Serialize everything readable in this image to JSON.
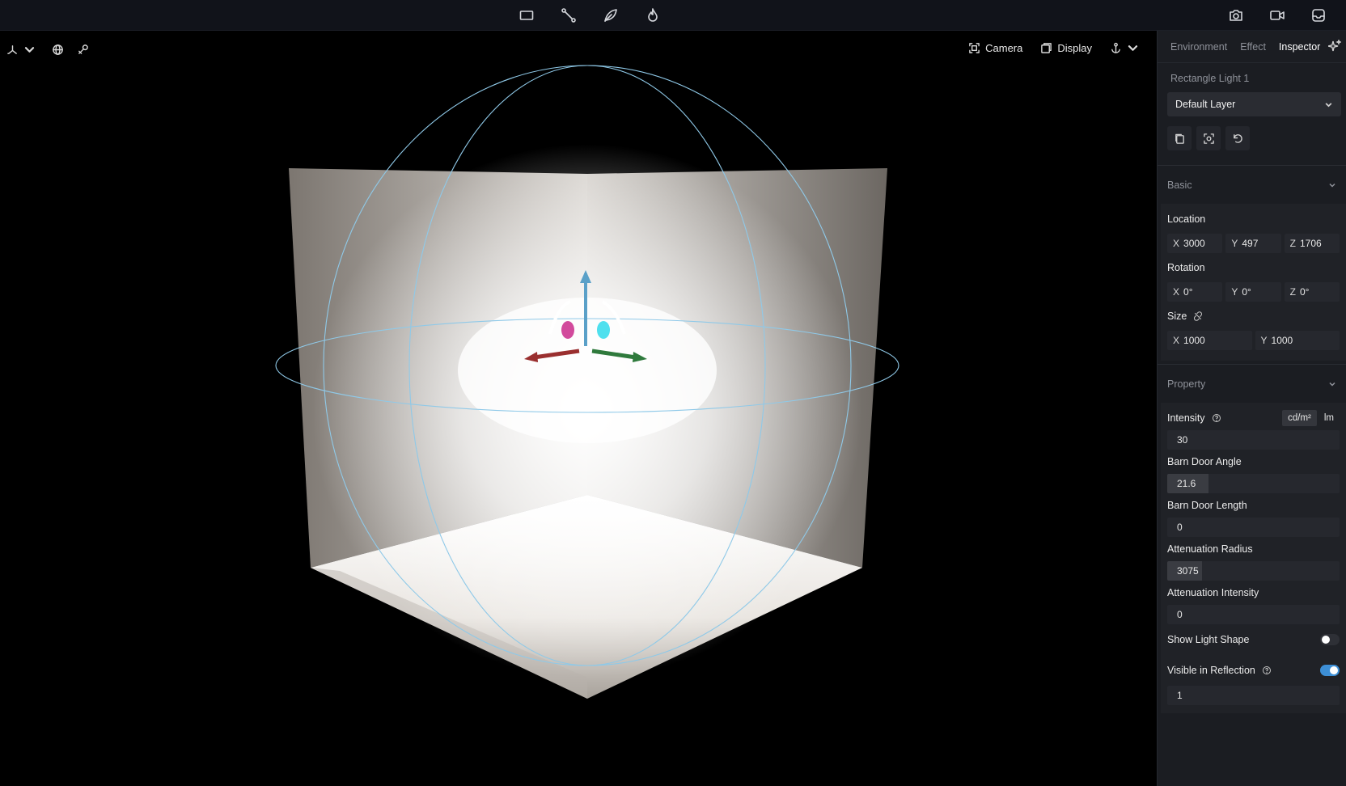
{
  "topbar": {
    "tools": [
      {
        "name": "rectangle-tool",
        "icon": "rectangle-icon"
      },
      {
        "name": "path-tool",
        "icon": "node-path-icon"
      },
      {
        "name": "leaf-tool",
        "icon": "leaf-icon"
      },
      {
        "name": "fire-tool",
        "icon": "flame-icon"
      }
    ],
    "capture": [
      {
        "name": "screenshot-button",
        "icon": "camera-icon"
      },
      {
        "name": "record-button",
        "icon": "video-icon"
      },
      {
        "name": "export-button",
        "icon": "tray-icon"
      }
    ]
  },
  "viewport": {
    "camera_label": "Camera",
    "display_label": "Display"
  },
  "panel": {
    "tabs": [
      {
        "label": "Environment",
        "active": false
      },
      {
        "label": "Effect",
        "active": false
      },
      {
        "label": "Inspector",
        "active": true
      }
    ],
    "object_name": "Rectangle Light 1",
    "layer": "Default Layer",
    "basic": {
      "title": "Basic",
      "location_label": "Location",
      "location": {
        "x": "3000",
        "y": "497",
        "z": "1706"
      },
      "rotation_label": "Rotation",
      "rotation": {
        "x": "0°",
        "y": "0°",
        "z": "0°"
      },
      "size_label": "Size",
      "size": {
        "x": "1000",
        "y": "1000"
      }
    },
    "property": {
      "title": "Property",
      "intensity_label": "Intensity",
      "units": [
        "cd/m²",
        "lm"
      ],
      "active_unit": "cd/m²",
      "intensity": "30",
      "barn_door_angle_label": "Barn Door Angle",
      "barn_door_angle": "21.6",
      "barn_door_angle_fill": 0.24,
      "barn_door_length_label": "Barn Door Length",
      "barn_door_length": "0",
      "attenuation_radius_label": "Attenuation Radius",
      "attenuation_radius": "3075",
      "attenuation_radius_fill": 0.2,
      "attenuation_intensity_label": "Attenuation Intensity",
      "attenuation_intensity": "0",
      "show_light_shape_label": "Show Light Shape",
      "show_light_shape": false,
      "visible_in_reflection_label": "Visible in Reflection",
      "visible_in_reflection": true,
      "reflection_value": "1"
    }
  }
}
